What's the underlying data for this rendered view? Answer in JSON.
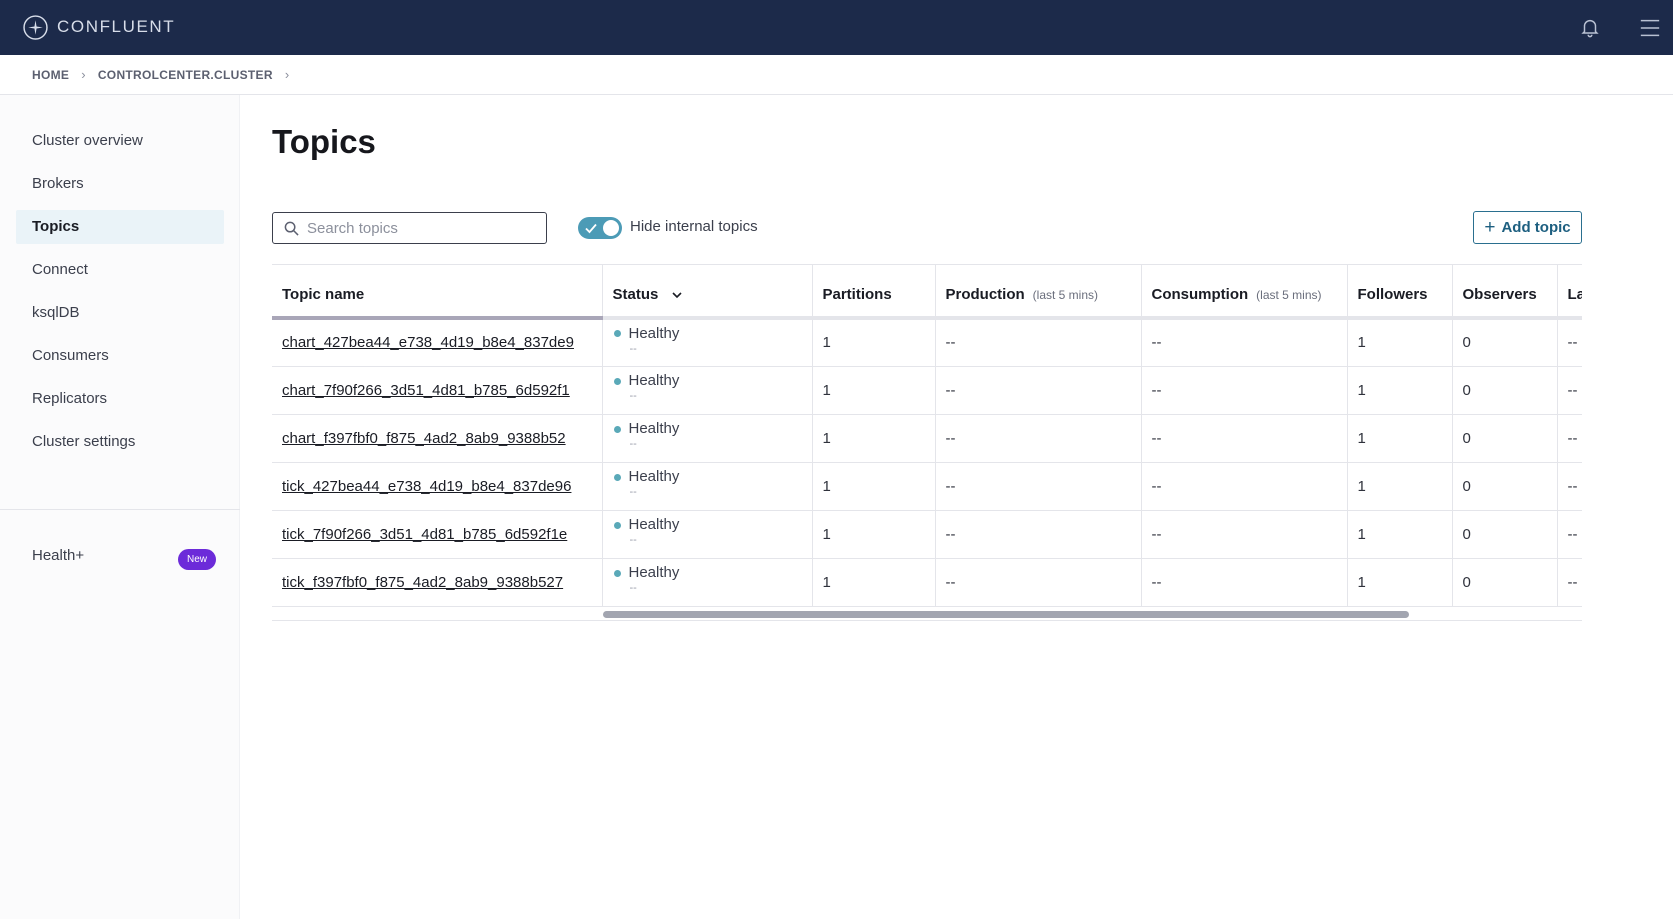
{
  "app": {
    "brand": "CONFLUENT"
  },
  "breadcrumb": {
    "items": [
      "HOME",
      "CONTROLCENTER.CLUSTER"
    ],
    "separator": "›"
  },
  "sidebar": {
    "items": [
      {
        "label": "Cluster overview",
        "active": false
      },
      {
        "label": "Brokers",
        "active": false
      },
      {
        "label": "Topics",
        "active": true
      },
      {
        "label": "Connect",
        "active": false
      },
      {
        "label": "ksqlDB",
        "active": false
      },
      {
        "label": "Consumers",
        "active": false
      },
      {
        "label": "Replicators",
        "active": false
      },
      {
        "label": "Cluster settings",
        "active": false
      }
    ],
    "health": {
      "label": "Health+",
      "badge": "New"
    }
  },
  "main": {
    "title": "Topics",
    "search": {
      "placeholder": "Search topics",
      "value": ""
    },
    "toggle": {
      "label": "Hide internal topics",
      "on": true
    },
    "add_button": {
      "label": "Add topic"
    }
  },
  "table": {
    "columns": {
      "name": "Topic name",
      "status": "Status",
      "partitions": "Partitions",
      "production": "Production",
      "production_sub": "(last 5 mins)",
      "consumption": "Consumption",
      "consumption_sub": "(last 5 mins)",
      "followers": "Followers",
      "observers": "Observers",
      "last": "La"
    },
    "rows": [
      {
        "name": "chart_427bea44_e738_4d19_b8e4_837de9",
        "status": "Healthy",
        "status_sub": "--",
        "partitions": "1",
        "production": "--",
        "consumption": "--",
        "followers": "1",
        "observers": "0",
        "last": "--"
      },
      {
        "name": "chart_7f90f266_3d51_4d81_b785_6d592f1",
        "status": "Healthy",
        "status_sub": "--",
        "partitions": "1",
        "production": "--",
        "consumption": "--",
        "followers": "1",
        "observers": "0",
        "last": "--"
      },
      {
        "name": "chart_f397fbf0_f875_4ad2_8ab9_9388b52",
        "status": "Healthy",
        "status_sub": "--",
        "partitions": "1",
        "production": "--",
        "consumption": "--",
        "followers": "1",
        "observers": "0",
        "last": "--"
      },
      {
        "name": "tick_427bea44_e738_4d19_b8e4_837de96",
        "status": "Healthy",
        "status_sub": "--",
        "partitions": "1",
        "production": "--",
        "consumption": "--",
        "followers": "1",
        "observers": "0",
        "last": "--"
      },
      {
        "name": "tick_7f90f266_3d51_4d81_b785_6d592f1e",
        "status": "Healthy",
        "status_sub": "--",
        "partitions": "1",
        "production": "--",
        "consumption": "--",
        "followers": "1",
        "observers": "0",
        "last": "--"
      },
      {
        "name": "tick_f397fbf0_f875_4ad2_8ab9_9388b527",
        "status": "Healthy",
        "status_sub": "--",
        "partitions": "1",
        "production": "--",
        "consumption": "--",
        "followers": "1",
        "observers": "0",
        "last": "--"
      }
    ]
  },
  "colors": {
    "topbar": "#1c2a4a",
    "accent": "#4c9bb6",
    "healthy": "#5aa9b8",
    "badge": "#6c2bd9"
  },
  "icons": [
    "confluent-logo-icon",
    "bell-icon",
    "hamburger-menu-icon",
    "search-icon",
    "check-icon",
    "chevron-down-icon",
    "plus-icon"
  ]
}
